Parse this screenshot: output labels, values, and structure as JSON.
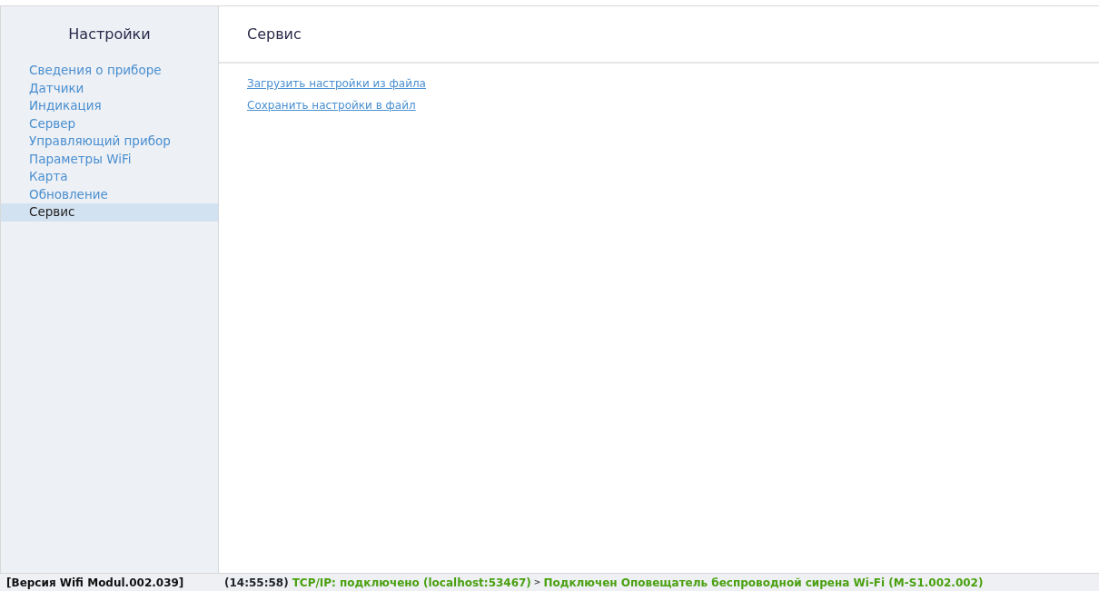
{
  "sidebar": {
    "title": "Настройки",
    "items": [
      {
        "label": "Сведения о приборе",
        "selected": false
      },
      {
        "label": "Датчики",
        "selected": false
      },
      {
        "label": "Индикация",
        "selected": false
      },
      {
        "label": "Сервер",
        "selected": false
      },
      {
        "label": "Управляющий прибор",
        "selected": false
      },
      {
        "label": "Параметры WiFi",
        "selected": false
      },
      {
        "label": "Карта",
        "selected": false
      },
      {
        "label": "Обновление",
        "selected": false
      },
      {
        "label": "Сервис",
        "selected": true
      }
    ]
  },
  "content": {
    "title": "Сервис",
    "links": [
      "Загрузить настройки из файла",
      "Сохранить настройки в файл"
    ]
  },
  "status_bar": {
    "version": "[Версия Wifi Modul.002.039]",
    "time": "(14:55:58)",
    "connection": "TCP/IP: подключено (localhost:53467)",
    "separator": ">",
    "device": "Подключен Оповещатель беспроводной сирена Wi-Fi (M-S1.002.002)"
  }
}
